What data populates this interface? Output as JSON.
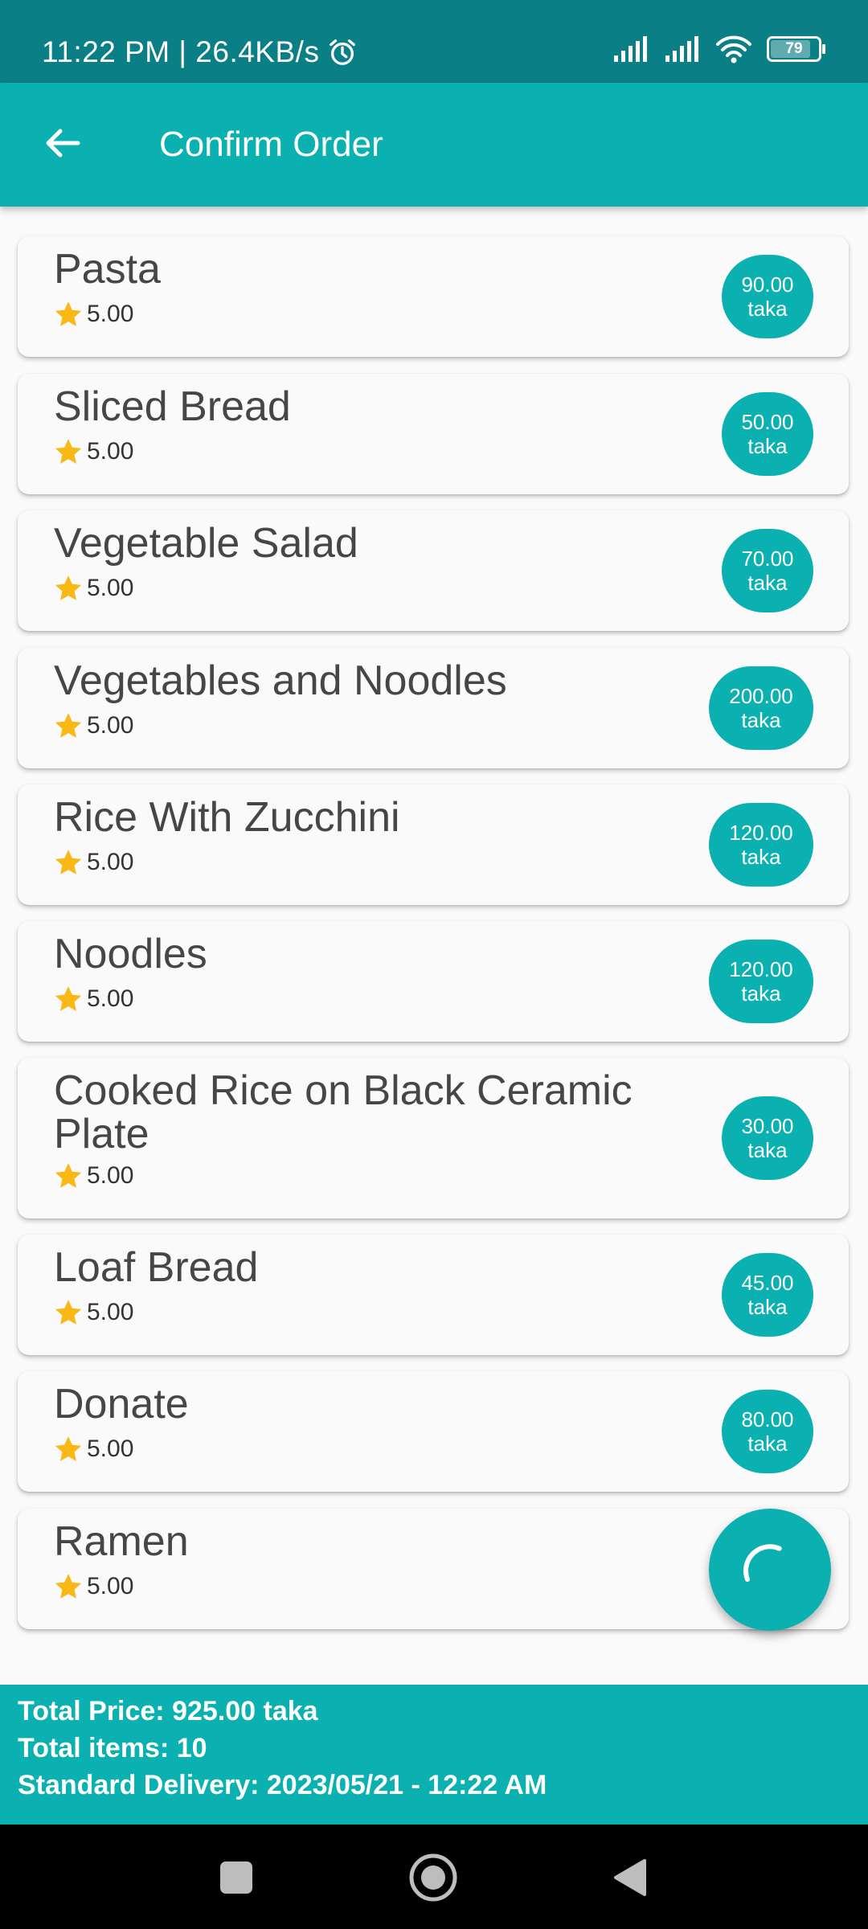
{
  "status_bar": {
    "time_speed": "11:22 PM | 26.4KB/s",
    "battery": "79",
    "icons": [
      "alarm-icon",
      "signal-icon",
      "signal-icon",
      "wifi-icon",
      "battery-icon"
    ]
  },
  "app_bar": {
    "back_icon": "arrow-left-icon",
    "title": "Confirm Order"
  },
  "items": [
    {
      "name": "Pasta",
      "rating": "5.00",
      "price": "90.00",
      "unit": "taka"
    },
    {
      "name": "Sliced Bread",
      "rating": "5.00",
      "price": "50.00",
      "unit": "taka"
    },
    {
      "name": "Vegetable Salad",
      "rating": "5.00",
      "price": "70.00",
      "unit": "taka"
    },
    {
      "name": "Vegetables and Noodles",
      "rating": "5.00",
      "price": "200.00",
      "unit": "taka"
    },
    {
      "name": "Rice With Zucchini",
      "rating": "5.00",
      "price": "120.00",
      "unit": "taka"
    },
    {
      "name": "Noodles",
      "rating": "5.00",
      "price": "120.00",
      "unit": "taka"
    },
    {
      "name": "Cooked Rice on Black Ceramic Plate",
      "rating": "5.00",
      "price": "30.00",
      "unit": "taka"
    },
    {
      "name": "Loaf Bread",
      "rating": "5.00",
      "price": "45.00",
      "unit": "taka"
    },
    {
      "name": "Donate",
      "rating": "5.00",
      "price": "80.00",
      "unit": "taka"
    },
    {
      "name": "Ramen",
      "rating": "5.00"
    }
  ],
  "fab_icon": "loading-spinner-icon",
  "summary": {
    "total_price": "Total Price: 925.00 taka",
    "total_items": "Total items: 10",
    "delivery": "Standard Delivery: 2023/05/21 - 12:22 AM"
  },
  "colors": {
    "status_bar": "#0b7f86",
    "accent": "#0bb0b0",
    "star": "#f9b815",
    "card_bg": "#fafafa",
    "text": "#464646"
  }
}
